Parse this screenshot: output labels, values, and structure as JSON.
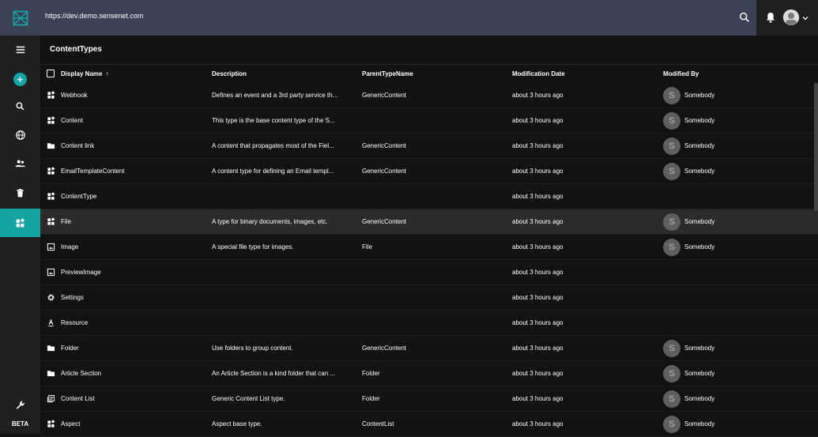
{
  "header": {
    "url": "https://dev.demo.sensenet.com",
    "brand_color": "#3b4256",
    "accent_color": "#13a5a5"
  },
  "sidebar": {
    "items": [
      {
        "icon": "menu-icon"
      },
      {
        "icon": "add-icon"
      },
      {
        "icon": "search-icon"
      },
      {
        "icon": "globe-icon"
      },
      {
        "icon": "users-icon"
      },
      {
        "icon": "trash-icon"
      },
      {
        "icon": "content-types-icon",
        "active": true
      }
    ],
    "settings_icon": "wrench-icon",
    "beta_label": "BETA"
  },
  "page": {
    "title": "ContentTypes"
  },
  "table": {
    "columns": {
      "display_name": "Display Name",
      "description": "Description",
      "parent": "ParentTypeName",
      "modified": "Modification Date",
      "modified_by": "Modified By"
    },
    "sort_indicator": "↑",
    "rows": [
      {
        "icon": "widgets-icon",
        "name": "Webhook",
        "description": "Defines an event and a 3rd party service th...",
        "parent": "GenericContent",
        "modified": "about 3 hours ago",
        "avatar": "S",
        "modified_by": "Somebody"
      },
      {
        "icon": "widgets-icon",
        "name": "Content",
        "description": "This type is the base content type of the S...",
        "parent": "",
        "modified": "about 3 hours ago",
        "avatar": "S",
        "modified_by": "Somebody"
      },
      {
        "icon": "folder-icon",
        "name": "Content link",
        "description": "A content that propagates most of the Fiel...",
        "parent": "GenericContent",
        "modified": "about 3 hours ago",
        "avatar": "S",
        "modified_by": "Somebody"
      },
      {
        "icon": "widgets-icon",
        "name": "EmailTemplateContent",
        "description": "A content type for defining an Email templ...",
        "parent": "GenericContent",
        "modified": "about 3 hours ago",
        "avatar": "S",
        "modified_by": "Somebody"
      },
      {
        "icon": "widgets-icon",
        "name": "ContentType",
        "description": "",
        "parent": "",
        "modified": "about 3 hours ago",
        "avatar": "",
        "modified_by": ""
      },
      {
        "icon": "widgets-icon",
        "name": "File",
        "description": "A type for binary documents, images, etc.",
        "parent": "GenericContent",
        "modified": "about 3 hours ago",
        "avatar": "S",
        "modified_by": "Somebody",
        "selected": true
      },
      {
        "icon": "image-icon",
        "name": "Image",
        "description": "A special file type for images.",
        "parent": "File",
        "modified": "about 3 hours ago",
        "avatar": "S",
        "modified_by": "Somebody"
      },
      {
        "icon": "image-icon",
        "name": "PreviewImage",
        "description": "",
        "parent": "",
        "modified": "about 3 hours ago",
        "avatar": "",
        "modified_by": ""
      },
      {
        "icon": "gear-icon",
        "name": "Settings",
        "description": "",
        "parent": "",
        "modified": "about 3 hours ago",
        "avatar": "",
        "modified_by": ""
      },
      {
        "icon": "text-format-icon",
        "name": "Resource",
        "description": "",
        "parent": "",
        "modified": "about 3 hours ago",
        "avatar": "",
        "modified_by": ""
      },
      {
        "icon": "folder-icon",
        "name": "Folder",
        "description": "Use folders to group content.",
        "parent": "GenericContent",
        "modified": "about 3 hours ago",
        "avatar": "S",
        "modified_by": "Somebody"
      },
      {
        "icon": "folder-icon",
        "name": "Article Section",
        "description": "An Article Section is a kind folder that can ...",
        "parent": "Folder",
        "modified": "about 3 hours ago",
        "avatar": "S",
        "modified_by": "Somebody"
      },
      {
        "icon": "list-icon",
        "name": "Content List",
        "description": "Generic Content List type.",
        "parent": "Folder",
        "modified": "about 3 hours ago",
        "avatar": "S",
        "modified_by": "Somebody"
      },
      {
        "icon": "widgets-icon",
        "name": "Aspect",
        "description": "Aspect base type.",
        "parent": "ContentList",
        "modified": "about 3 hours ago",
        "avatar": "S",
        "modified_by": "Somebody"
      }
    ]
  }
}
